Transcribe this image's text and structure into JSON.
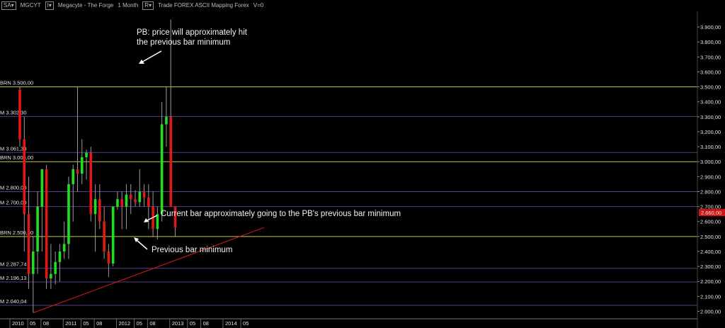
{
  "toolbar": {
    "mode_label": "SA",
    "symbol": "MGCYT",
    "name_label": "Megacyte - The Forge",
    "timeframe": "1 Month",
    "menu_label": "Trade  FOREX  ASCII Mapping  Forex",
    "volume": "V=0"
  },
  "colors": {
    "up": "#1ee01e",
    "down": "#e01818",
    "yellow_level": "#c9c94a",
    "purple_level": "#5a3c8c",
    "trend": "#d61e1e"
  },
  "chart_data": {
    "type": "candlestick",
    "title": "",
    "xlabel": "",
    "ylabel": "",
    "ylim": [
      1955,
      4000
    ],
    "grid": false,
    "y_ticks": [
      "2.000,00",
      "2.100,00",
      "2.200,00",
      "2.300,00",
      "2.400,00",
      "2.500,00",
      "2.600,00",
      "2.700,00",
      "2.800,00",
      "2.900,00",
      "3.000,00",
      "3.100,00",
      "3.200,00",
      "3.300,00",
      "3.400,00",
      "3.500,00",
      "3.600,00",
      "3.700,00",
      "3.800,00",
      "3.900,00"
    ],
    "y_tick_values": [
      2000,
      2100,
      2200,
      2300,
      2400,
      2500,
      2600,
      2700,
      2800,
      2900,
      3000,
      3100,
      3200,
      3300,
      3400,
      3500,
      3600,
      3700,
      3800,
      3900
    ],
    "x_labels": [
      {
        "text": "2010",
        "i": 0
      },
      {
        "text": "05",
        "i": 4
      },
      {
        "text": "08",
        "i": 7
      },
      {
        "text": "2011",
        "i": 12
      },
      {
        "text": "05",
        "i": 16
      },
      {
        "text": "08",
        "i": 19
      },
      {
        "text": "2012",
        "i": 24
      },
      {
        "text": "05",
        "i": 28
      },
      {
        "text": "08",
        "i": 31
      },
      {
        "text": "2013",
        "i": 36
      },
      {
        "text": "05",
        "i": 40
      },
      {
        "text": "08",
        "i": 43
      },
      {
        "text": "2014",
        "i": 48
      },
      {
        "text": "05",
        "i": 52
      }
    ],
    "candles": [
      {
        "o": 3480,
        "h": 3500,
        "l": 3100,
        "c": 3150
      },
      {
        "o": 3150,
        "h": 3300,
        "l": 2400,
        "c": 2650
      },
      {
        "o": 2650,
        "h": 2900,
        "l": 2150,
        "c": 2250
      },
      {
        "o": 2250,
        "h": 2500,
        "l": 1990,
        "c": 2400
      },
      {
        "o": 2400,
        "h": 2800,
        "l": 2250,
        "c": 2700
      },
      {
        "o": 2700,
        "h": 2950,
        "l": 2400,
        "c": 2950
      },
      {
        "o": 2950,
        "h": 2980,
        "l": 2150,
        "c": 2220
      },
      {
        "o": 2220,
        "h": 2450,
        "l": 2150,
        "c": 2250
      },
      {
        "o": 2250,
        "h": 2400,
        "l": 2180,
        "c": 2330
      },
      {
        "o": 2330,
        "h": 2450,
        "l": 2200,
        "c": 2400
      },
      {
        "o": 2400,
        "h": 2600,
        "l": 2350,
        "c": 2450
      },
      {
        "o": 2450,
        "h": 2900,
        "l": 2350,
        "c": 2850
      },
      {
        "o": 2850,
        "h": 2980,
        "l": 2600,
        "c": 2950
      },
      {
        "o": 2950,
        "h": 3500,
        "l": 2800,
        "c": 2920
      },
      {
        "o": 2920,
        "h": 3150,
        "l": 2850,
        "c": 3030
      },
      {
        "o": 3030,
        "h": 3080,
        "l": 2880,
        "c": 3060
      },
      {
        "o": 3060,
        "h": 3100,
        "l": 2600,
        "c": 2650
      },
      {
        "o": 2650,
        "h": 2850,
        "l": 2400,
        "c": 2750
      },
      {
        "o": 2750,
        "h": 2850,
        "l": 2550,
        "c": 2600
      },
      {
        "o": 2600,
        "h": 2700,
        "l": 2350,
        "c": 2400
      },
      {
        "o": 2400,
        "h": 2450,
        "l": 2230,
        "c": 2320
      },
      {
        "o": 2320,
        "h": 2700,
        "l": 2300,
        "c": 2700
      },
      {
        "o": 2700,
        "h": 2800,
        "l": 2680,
        "c": 2750
      },
      {
        "o": 2750,
        "h": 2800,
        "l": 2550,
        "c": 2700
      },
      {
        "o": 2700,
        "h": 2850,
        "l": 2550,
        "c": 2780
      },
      {
        "o": 2780,
        "h": 2850,
        "l": 2650,
        "c": 2750
      },
      {
        "o": 2750,
        "h": 2810,
        "l": 2700,
        "c": 2730
      },
      {
        "o": 2730,
        "h": 2950,
        "l": 2700,
        "c": 2800
      },
      {
        "o": 2800,
        "h": 2850,
        "l": 2700,
        "c": 2760
      },
      {
        "o": 2760,
        "h": 2850,
        "l": 2550,
        "c": 2700
      },
      {
        "o": 2700,
        "h": 2800,
        "l": 2500,
        "c": 2550
      },
      {
        "o": 2550,
        "h": 2700,
        "l": 2480,
        "c": 2650
      },
      {
        "o": 2650,
        "h": 3400,
        "l": 2600,
        "c": 3250
      },
      {
        "o": 3250,
        "h": 3500,
        "l": 3100,
        "c": 3300
      },
      {
        "o": 3300,
        "h": 3950,
        "l": 2950,
        "c": 2700
      },
      {
        "o": 2700,
        "h": 2700,
        "l": 2500,
        "c": 2560
      }
    ],
    "levels": [
      {
        "label": "BRN 3.500,00",
        "value": 3500,
        "kind": "yellow"
      },
      {
        "label": "M 3.302,30",
        "value": 3302.3,
        "kind": "purple"
      },
      {
        "label": "M 3.061,38",
        "value": 3061.38,
        "kind": "purple"
      },
      {
        "label": "BRN 3.000,00",
        "value": 3000,
        "kind": "yellow"
      },
      {
        "label": "M 2.800,00",
        "value": 2800,
        "kind": "purple"
      },
      {
        "label": "M 2.700,00",
        "value": 2700,
        "kind": "purple"
      },
      {
        "label": "BRN 2.500,00",
        "value": 2500,
        "kind": "yellow"
      },
      {
        "label": "M 2.287,74",
        "value": 2287.74,
        "kind": "purple"
      },
      {
        "label": "M 2.196,13",
        "value": 2196.13,
        "kind": "purple"
      },
      {
        "label": "M 2.040,04",
        "value": 2040.04,
        "kind": "purple"
      }
    ],
    "current_price": {
      "label": "2.660,00",
      "value": 2660
    },
    "trendline": {
      "from": {
        "i": 3,
        "v": 1990
      },
      "to": {
        "i": 55,
        "v": 2560
      }
    },
    "annotations": [
      {
        "text_lines": [
          "PB: price will approximately hit",
          "the previous bar minimum"
        ]
      },
      {
        "text_lines": [
          "Current bar approximately going to the PB's previous bar minimum"
        ]
      },
      {
        "text_lines": [
          "Previous bar minimum"
        ]
      }
    ]
  }
}
